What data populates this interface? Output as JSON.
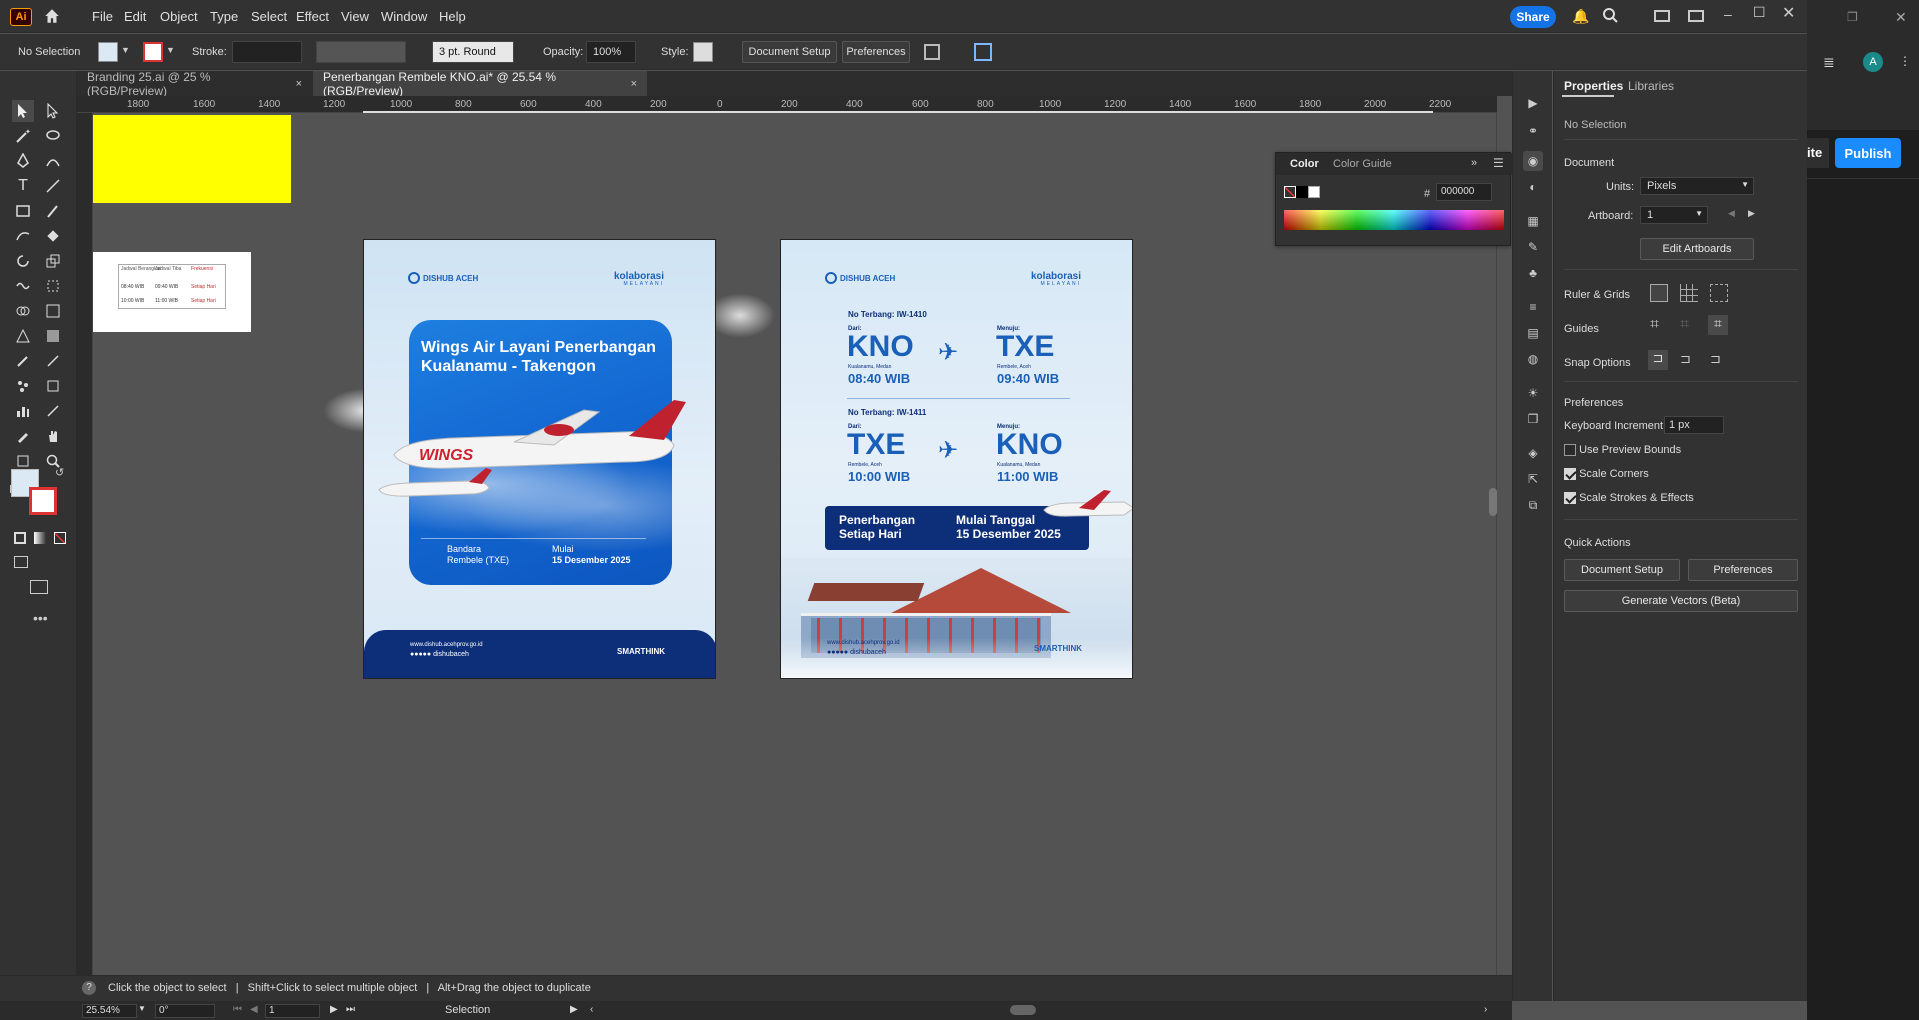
{
  "app": {
    "logo_text": "Ai",
    "menu": [
      "File",
      "Edit",
      "Object",
      "Type",
      "Select",
      "Effect",
      "View",
      "Window",
      "Help"
    ],
    "share_label": "Share",
    "publish_label": "Publish",
    "side_partial_label": "ite",
    "avatar_letter": "A"
  },
  "control": {
    "selection": "No Selection",
    "stroke_label": "Stroke:",
    "brush_label": "3 pt. Round",
    "opacity_label": "Opacity:",
    "opacity_value": "100%",
    "style_label": "Style:",
    "document_setup": "Document Setup",
    "preferences": "Preferences"
  },
  "tabs": [
    {
      "label": "Branding 25.ai @ 25 % (RGB/Preview)",
      "close": "×"
    },
    {
      "label": "Penerbangan Rembele KNO.ai* @ 25.54 % (RGB/Preview)",
      "close": "×"
    }
  ],
  "ruler": {
    "top_ticks": [
      "1800",
      "1600",
      "1400",
      "1200",
      "1000",
      "800",
      "600",
      "400",
      "200",
      "0",
      "200",
      "400",
      "600",
      "800",
      "1000",
      "1200",
      "1400",
      "1600",
      "1800",
      "2000",
      "2200"
    ],
    "left_ticks": [
      "0",
      "1 4 0",
      "1 2 0",
      "1 0",
      "8",
      "6",
      "4",
      "2",
      "0",
      "2",
      "4",
      "6",
      "8"
    ]
  },
  "color_panel": {
    "tab_color": "Color",
    "tab_guide": "Color Guide",
    "hex_label": "#",
    "hex_value": "000000"
  },
  "properties": {
    "tab_properties": "Properties",
    "tab_libraries": "Libraries",
    "no_selection": "No Selection",
    "document_heading": "Document",
    "units_label": "Units:",
    "units_value": "Pixels",
    "artboard_label": "Artboard:",
    "artboard_value": "1",
    "edit_artboards": "Edit Artboards",
    "ruler_grids": "Ruler & Grids",
    "guides": "Guides",
    "snap_options": "Snap Options",
    "preferences_heading": "Preferences",
    "keyboard_increment_label": "Keyboard Increment:",
    "keyboard_increment_value": "1 px",
    "use_preview_bounds": "Use Preview Bounds",
    "scale_corners": "Scale Corners",
    "scale_strokes": "Scale Strokes & Effects",
    "quick_actions": "Quick Actions",
    "qa_document_setup": "Document Setup",
    "qa_preferences": "Preferences",
    "generate_vectors": "Generate Vectors (Beta)"
  },
  "status": {
    "hint_1": "Click the object to select",
    "hint_2": "Shift+Click to select multiple object",
    "hint_3": "Alt+Drag the object to duplicate",
    "zoom": "25.54%",
    "rotation": "0°",
    "artboard_nav": "1",
    "tool_name": "Selection"
  },
  "table_snippet": {
    "headers": [
      "Jadwal Berangkat",
      "Jadwal Tiba",
      "Frekuensi"
    ],
    "rows": [
      [
        "08:40 WIB",
        "09:40 WIB",
        "Setiap Hari"
      ],
      [
        "10:00 WIB",
        "11:00 WIB",
        "Setiap Hari"
      ]
    ]
  },
  "artboard1": {
    "logo_left": "DISHUB ACEH",
    "logo_right": "kolaborasi",
    "logo_right_sub": "MELAYANI",
    "title": "Wings Air Layani Penerbangan Kualanamu - Takengon",
    "plane_livery": "WINGS",
    "airport_label_1": "Bandara",
    "airport_label_2": "Rembele (TXE)",
    "start_label_1": "Mulai",
    "start_label_2": "15 Desember 2025",
    "footer_web": "www.dishub.acehprov.go.id",
    "footer_social": "dishubaceh",
    "footer_brand": "SMARTHINK"
  },
  "artboard2": {
    "logo_left": "DISHUB ACEH",
    "logo_right": "kolaborasi",
    "logo_right_sub": "MELAYANI",
    "flight1": {
      "no": "No Terbang: IW-1410",
      "from_label": "Dari:",
      "from": "KNO",
      "from_city": "Kualanamu, Medan",
      "from_time": "08:40 WIB",
      "to_label": "Menuju:",
      "to": "TXE",
      "to_city": "Rembele, Aceh",
      "to_time": "09:40 WIB"
    },
    "flight2": {
      "no": "No Terbang: IW-1411",
      "from_label": "Dari:",
      "from": "TXE",
      "from_city": "Rembele, Aceh",
      "from_time": "10:00 WIB",
      "to_label": "Menuju:",
      "to": "KNO",
      "to_city": "Kualanamu, Medan",
      "to_time": "11:00 WIB"
    },
    "banner_left_1": "Penerbangan",
    "banner_left_2": "Setiap Hari",
    "banner_right_1": "Mulai Tanggal",
    "banner_right_2": "15 Desember 2025",
    "footer_web": "www.dishub.acehprov.go.id",
    "footer_social": "dishubaceh",
    "footer_brand": "SMARTHINK"
  },
  "colors": {
    "accent": "#1473e6",
    "yellow_rect": "#ffff00",
    "brand_blue": "#1a5fb8",
    "navy": "#0d2f7a"
  }
}
